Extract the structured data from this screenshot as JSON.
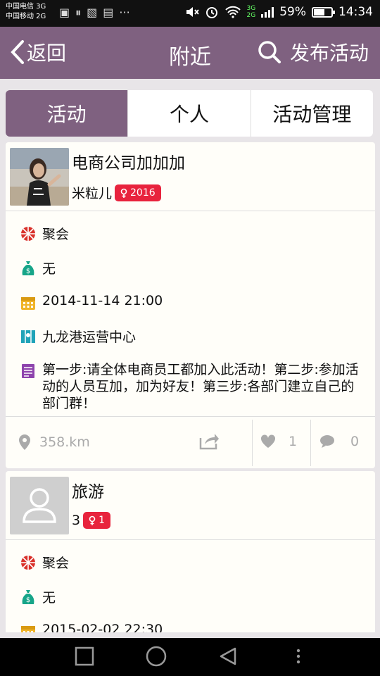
{
  "status_bar": {
    "carrier1": "中国电信 3G",
    "carrier2": "中国移动 2G",
    "net1": "3G",
    "net2": "2G",
    "battery": "59%",
    "battery_level": 0.59,
    "time": "14:34"
  },
  "header": {
    "back_label": "返回",
    "title": "附近",
    "publish_label": "发布活动"
  },
  "tabs": [
    {
      "label": "活动",
      "active": true
    },
    {
      "label": "个人",
      "active": false
    },
    {
      "label": "活动管理",
      "active": false
    }
  ],
  "cards": [
    {
      "title": "电商公司加加加",
      "author": "米粒儿",
      "badge": "2016",
      "type": "聚会",
      "fee": "无",
      "datetime": "2014-11-14 21:00",
      "location": "九龙港运营中心",
      "description": "第一步:请全体电商员工都加入此活动！第二步:参加活动的人员互加，加为好友！第三步:各部门建立自己的部门群！",
      "distance": "358.km",
      "likes": "1",
      "comments": "0"
    },
    {
      "title": "旅游",
      "author": "3",
      "badge": "1",
      "type": "聚会",
      "fee": "无",
      "datetime": "2015-02-02 22:30"
    }
  ],
  "colors": {
    "accent": "#7f6180",
    "badge": "#e8233d"
  }
}
